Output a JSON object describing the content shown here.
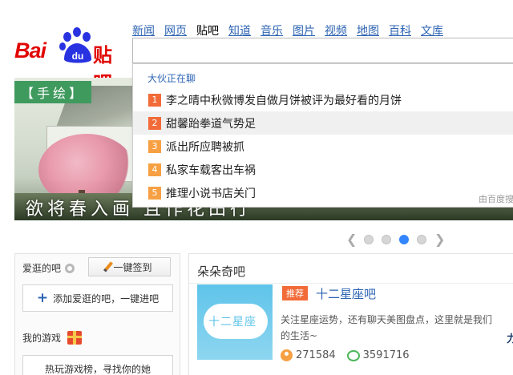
{
  "logo": {
    "text_bai": "Bai",
    "text_du": "du",
    "text_tieba": "贴吧",
    "alt": "Baidu贴吧"
  },
  "nav": [
    {
      "label": "新闻",
      "current": false
    },
    {
      "label": "网页",
      "current": false
    },
    {
      "label": "贴吧",
      "current": true
    },
    {
      "label": "知道",
      "current": false
    },
    {
      "label": "音乐",
      "current": false
    },
    {
      "label": "图片",
      "current": false
    },
    {
      "label": "视频",
      "current": false
    },
    {
      "label": "地图",
      "current": false
    },
    {
      "label": "百科",
      "current": false
    },
    {
      "label": "文库",
      "current": false
    }
  ],
  "search": {
    "value": ""
  },
  "suggest": {
    "heading": "大伙正在聊",
    "items": [
      {
        "rank": "1",
        "text": "李之晴中秋微博发自做月饼被评为最好看的月饼"
      },
      {
        "rank": "2",
        "text": "甜馨跆拳道气势足"
      },
      {
        "rank": "3",
        "text": "派出所应聘被抓"
      },
      {
        "rank": "4",
        "text": "私家车载客出车祸"
      },
      {
        "rank": "5",
        "text": "推理小说书店关门"
      }
    ],
    "source": "由百度搜"
  },
  "banner": {
    "tag": "【手绘】",
    "caption": "欲将春入画 且作花田行"
  },
  "carousel": {
    "dots": 4,
    "active_index": 2
  },
  "left_panel": {
    "favorites_title": "爱逛的吧",
    "sign_in_label": "一键签到",
    "add_label": "添加爱逛的吧，一键进吧",
    "games_title": "我的游戏",
    "games_button": "热玩游戏榜，寻找你的她"
  },
  "right_panel": {
    "title": "朵朵奇吧",
    "thumb_text": "十二星座",
    "badge": "推荐",
    "bar_name": "十二星座吧",
    "description": "关注星座运势，还有聊天美图盘点，这里就是我们的生活~",
    "members": "271584",
    "posts": "3591716",
    "edge_text": "力"
  },
  "colors": {
    "brand_red": "#e10602",
    "link_blue": "#2d64b3",
    "rank_orange": "#f26b38",
    "accent_blue": "#3385ff"
  }
}
